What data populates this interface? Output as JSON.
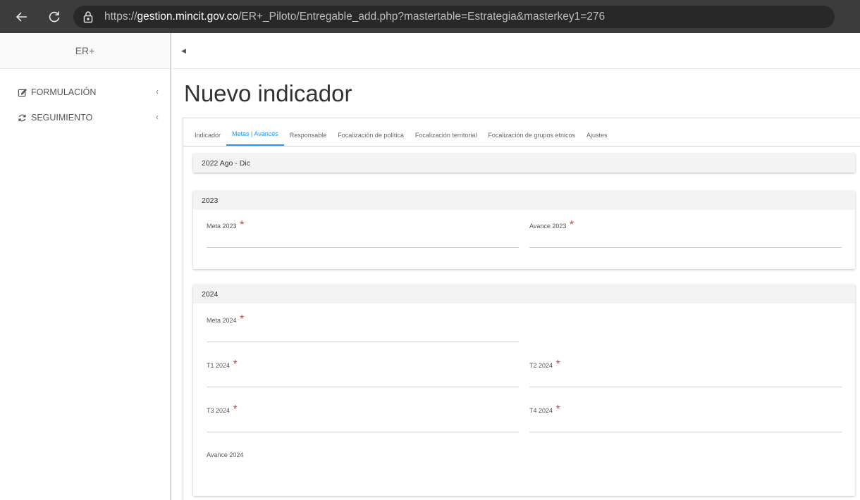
{
  "browser": {
    "url_scheme": "https://",
    "url_host": "gestion.mincit.gov.co",
    "url_path": "/ER+_Piloto/Entregable_add.php?mastertable=Estrategia&masterkey1=276"
  },
  "sidebar": {
    "brand": "ER+",
    "items": [
      {
        "label": "FORMULACIÓN",
        "icon": "edit-icon"
      },
      {
        "label": "SEGUIMIENTO",
        "icon": "refresh-icon"
      }
    ]
  },
  "page": {
    "title": "Nuevo indicador"
  },
  "tabs": [
    {
      "label": "Indicador",
      "active": false
    },
    {
      "label": "Metas | Avances",
      "active": true
    },
    {
      "label": "Responsable",
      "active": false
    },
    {
      "label": "Focalización de política",
      "active": false
    },
    {
      "label": "Focalización territorial",
      "active": false
    },
    {
      "label": "Focalización de grupos etnicos",
      "active": false
    },
    {
      "label": "Ajustes",
      "active": false
    }
  ],
  "sections": {
    "s2022": {
      "title": "2022 Ago - Dic"
    },
    "s2023": {
      "title": "2023",
      "meta": {
        "label": "Meta 2023",
        "required": "*"
      },
      "avance": {
        "label": "Avance 2023",
        "required": "*"
      }
    },
    "s2024": {
      "title": "2024",
      "meta": {
        "label": "Meta 2024",
        "required": "*"
      },
      "t1": {
        "label": "T1 2024",
        "required": "*"
      },
      "t2": {
        "label": "T2 2024",
        "required": "*"
      },
      "t3": {
        "label": "T3 2024",
        "required": "*"
      },
      "t4": {
        "label": "T4 2024",
        "required": "*"
      },
      "avance": {
        "label": "Avance 2024"
      }
    }
  },
  "colors": {
    "accent": "#2196f3",
    "required": "#e53935"
  }
}
